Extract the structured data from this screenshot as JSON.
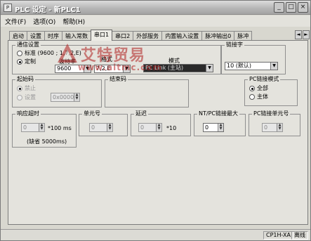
{
  "window": {
    "title": "PLC 设定 - 新PLC1",
    "icon_label": "P",
    "minimize": "_",
    "maximize": "□",
    "close": "×"
  },
  "menu": [
    "文件(F)",
    "选项(O)",
    "帮助(H)"
  ],
  "tabs": [
    "启动",
    "设置",
    "时序",
    "输入常数",
    "串口1",
    "串口2",
    "外部服务",
    "内置输入设置",
    "脉冲输出0",
    "脉冲"
  ],
  "active_tab": "串口1",
  "tab_scroll": {
    "left": "◄",
    "right": "►"
  },
  "comm": {
    "group_title": "通信设置",
    "standard_label": "标准 (9600 ; 1,7,2,E)",
    "custom_label": "定制",
    "baud_label": "波特率",
    "baud_value": "9600",
    "format_label": "格式",
    "format_value": "7,2,E",
    "mode_label": "模式",
    "mode_value": "PC Link (主站)"
  },
  "link": {
    "group_title": "链接字",
    "value": "10 (默认)"
  },
  "start_code": {
    "group_title": "起始码",
    "disable_label": "禁止",
    "set_label": "设置",
    "value": "0x0000"
  },
  "end_code": {
    "group_title": "结束码"
  },
  "pc_link_mode": {
    "group_title": "PC链接模式",
    "all_label": "全部",
    "master_label": "主体"
  },
  "response_timeout": {
    "group_title": "响应超时",
    "value": "0",
    "unit": "*100 ms",
    "default_note": "(缺省 5000ms)"
  },
  "unit_no": {
    "group_title": "单元号",
    "value": "0"
  },
  "delay": {
    "group_title": "延迟",
    "value": "0",
    "unit": "*10"
  },
  "nt_pc_max": {
    "group_title": "NT/PC链接最大",
    "value": "0"
  },
  "pc_link_unit": {
    "group_title": "PC链接单元号",
    "value": "0"
  },
  "watermark": {
    "brand": "艾特贸易",
    "url": "www.aitmc.com"
  },
  "status": {
    "model": "CP1H-XA",
    "state": "离线"
  }
}
